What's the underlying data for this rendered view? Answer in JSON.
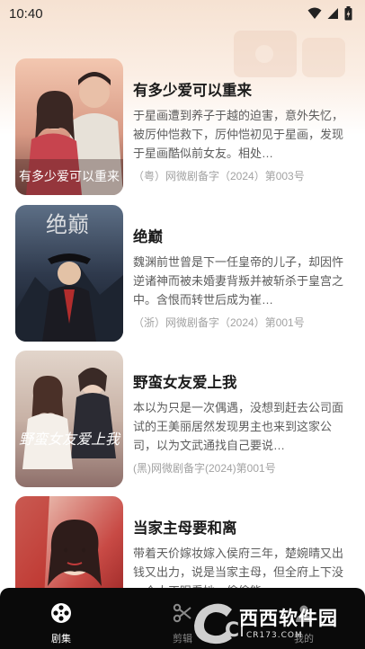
{
  "status_bar": {
    "time": "10:40",
    "icons": [
      "wifi-icon",
      "cell-signal-icon",
      "battery-icon"
    ]
  },
  "dramas": [
    {
      "title": "有多少爱可以重来",
      "description": "于星画遭到养子于越的迫害，意外失忆，被厉仲恺救下，厉仲恺初见于星画，发现于星画酷似前女友。相处…",
      "license": "（粤）网微剧备字（2024）第003号",
      "poster_text": "有多少爱可以重来"
    },
    {
      "title": "绝巅",
      "description": "魏渊前世曾是下一任皇帝的儿子，却因忤逆诸神而被未婚妻背叛并被斩杀于皇宫之中。含恨而转世后成为崔…",
      "license": "（浙）网微剧备字（2024）第001号",
      "poster_text": "绝巅"
    },
    {
      "title": "野蛮女友爱上我",
      "description": "本以为只是一次偶遇，没想到赶去公司面试的王美丽居然发现男主也来到这家公司，以为文武通找自己要说…",
      "license": "(黑)网微剧备字(2024)第001号",
      "poster_text": "野蛮女友爱上我"
    },
    {
      "title": "当家主母要和离",
      "description": "带着天价嫁妆嫁入侯府三年，楚婉晴又出钱又出力，说是当家主母，但全府上下没一个人正眼看她，偷偷能…",
      "license": "",
      "poster_text": ""
    }
  ],
  "bottom_nav": [
    {
      "label": "剧集",
      "icon": "film-reel-icon",
      "active": true
    },
    {
      "label": "剪辑",
      "icon": "scissors-icon",
      "active": false
    },
    {
      "label": "我的",
      "icon": "person-icon",
      "active": false
    }
  ],
  "watermark": {
    "brand": "西西软件园",
    "url": "CR173.COM",
    "letter": "Cr"
  },
  "colors": {
    "accent_bg": "#f6e2d2",
    "nav_bg": "#0a0a0a",
    "title": "#1c1c1c",
    "desc": "#5c5c5c",
    "license": "#a2a2a2"
  }
}
